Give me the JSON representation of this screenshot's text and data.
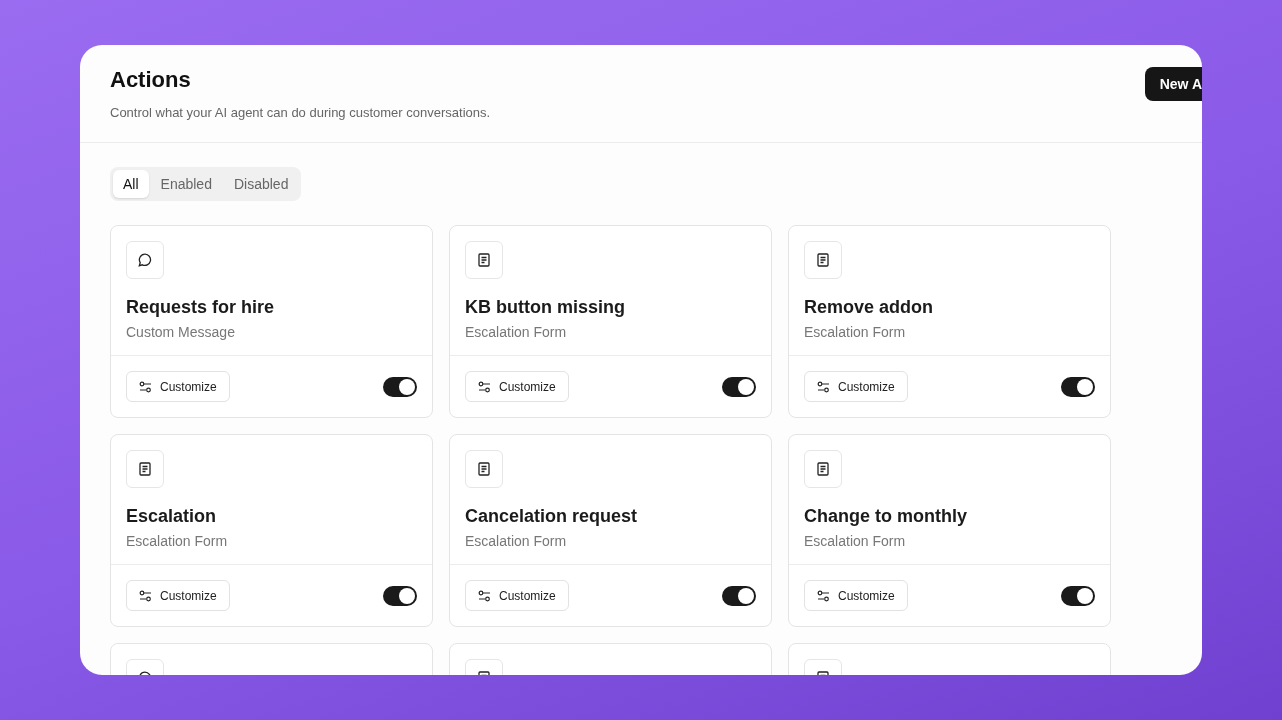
{
  "header": {
    "title": "Actions",
    "subtitle": "Control what your AI agent can do during customer conversations.",
    "new_button": "New A"
  },
  "filter_tabs": [
    {
      "label": "All",
      "selected": true
    },
    {
      "label": "Enabled",
      "selected": false
    },
    {
      "label": "Disabled",
      "selected": false
    }
  ],
  "cards": [
    {
      "kind": "message",
      "title": "Requests for hire",
      "type": "Custom Message",
      "button": "Customize",
      "on": true
    },
    {
      "kind": "form",
      "title": "KB button missing",
      "type": "Escalation Form",
      "button": "Customize",
      "on": true
    },
    {
      "kind": "form",
      "title": "Remove addon",
      "type": "Escalation Form",
      "button": "Customize",
      "on": true
    },
    {
      "kind": "form",
      "title": "Escalation",
      "type": "Escalation Form",
      "button": "Customize",
      "on": true
    },
    {
      "kind": "form",
      "title": "Cancelation request",
      "type": "Escalation Form",
      "button": "Customize",
      "on": true
    },
    {
      "kind": "form",
      "title": "Change to monthly",
      "type": "Escalation Form",
      "button": "Customize",
      "on": true
    },
    {
      "kind": "message"
    },
    {
      "kind": "form"
    },
    {
      "kind": "form"
    }
  ]
}
